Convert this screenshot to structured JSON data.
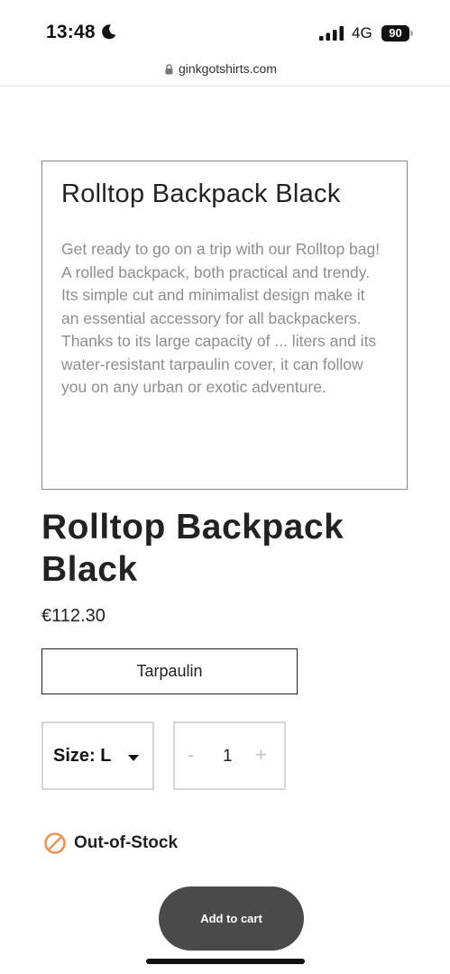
{
  "status_bar": {
    "time": "13:48",
    "network": "4G",
    "battery": "90",
    "icons": [
      "moon-icon",
      "signal-icon",
      "battery-icon"
    ]
  },
  "browser": {
    "url": "ginkgotshirts.com",
    "icon": "lock-icon"
  },
  "description_card": {
    "title": "Rolltop Backpack Black",
    "text": "Get ready to go on a trip with our Rolltop bag! A rolled backpack, both practical and trendy. Its simple cut and minimalist design make it an essential accessory for all backpackers. Thanks to its large capacity of ... liters and its water-resistant tarpaulin cover, it can follow you on any urban or exotic adventure."
  },
  "product": {
    "title": "Rolltop Backpack Black",
    "price": "€112.30",
    "variant_label": "Tarpaulin",
    "size_label": "Size: L",
    "quantity": {
      "minus": "-",
      "value": "1",
      "plus": "+"
    },
    "stock_status": "Out-of-Stock",
    "add_to_cart_label": "Add to cart"
  },
  "colors": {
    "stock_icon": "#e8955a",
    "cart_button": "#4a4a4a",
    "description_text": "#8e8e8e"
  }
}
